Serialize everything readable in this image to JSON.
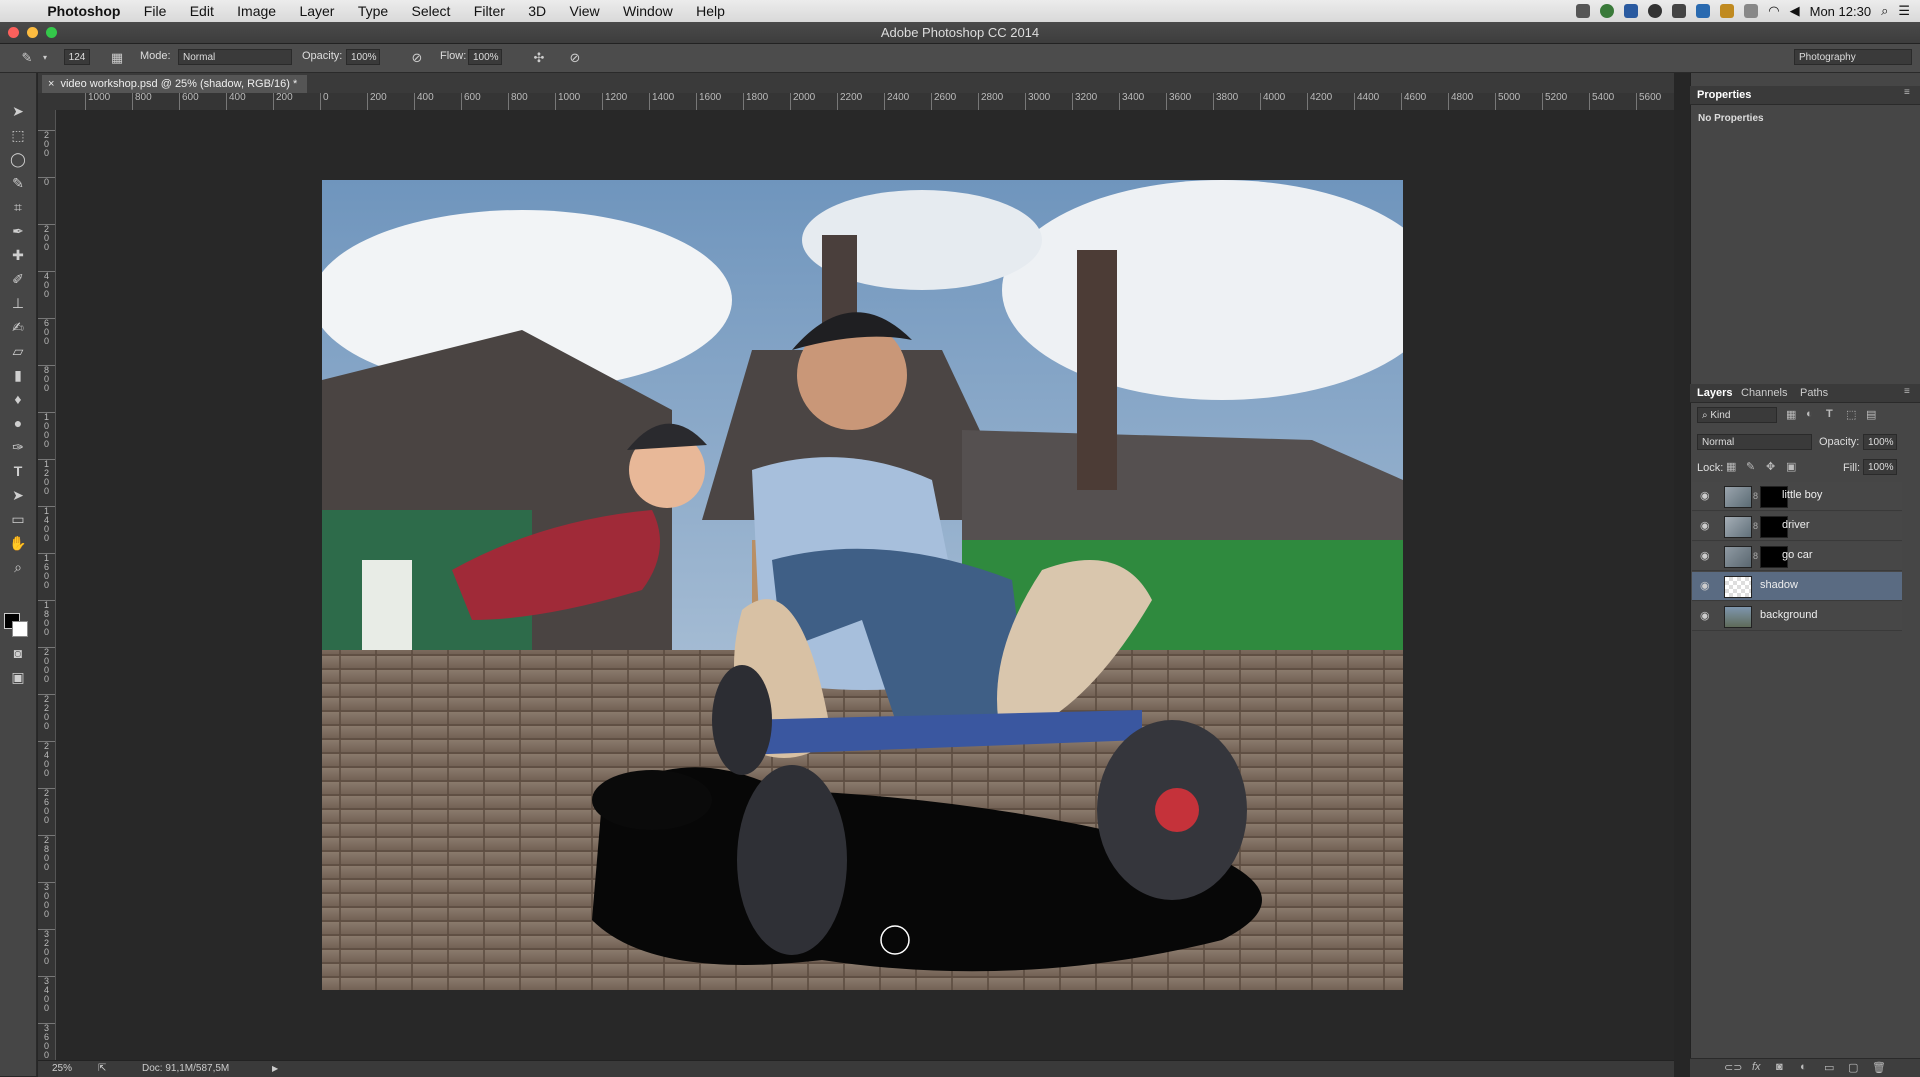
{
  "menubar": {
    "app": "Photoshop",
    "items": [
      "File",
      "Edit",
      "Image",
      "Layer",
      "Type",
      "Select",
      "Filter",
      "3D",
      "View",
      "Window",
      "Help"
    ],
    "clock": "Mon 12:30"
  },
  "window": {
    "title": "Adobe Photoshop CC 2014"
  },
  "options": {
    "brush_size": "124",
    "mode_label": "Mode:",
    "mode_value": "Normal",
    "opacity_label": "Opacity:",
    "opacity_value": "100%",
    "flow_label": "Flow:",
    "flow_value": "100%",
    "workspace": "Photography"
  },
  "document": {
    "tab_label": "video workshop.psd @ 25% (shadow, RGB/16) *",
    "zoom": "25%",
    "doc_info": "Doc: 91,1M/587,5M"
  },
  "hruler": [
    "1000",
    "800",
    "600",
    "400",
    "200",
    "0",
    "200",
    "400",
    "600",
    "800",
    "1000",
    "1200",
    "1400",
    "1600",
    "1800",
    "2000",
    "2200",
    "2400",
    "2600",
    "2800",
    "3000",
    "3200",
    "3400",
    "3600",
    "3800",
    "4000",
    "4200",
    "4400",
    "4600",
    "4800",
    "5000",
    "5200",
    "5400",
    "5600"
  ],
  "vruler": [
    "200",
    "0",
    "200",
    "400",
    "600",
    "800",
    "1000",
    "1200",
    "1400",
    "1600",
    "1800",
    "2000",
    "2200",
    "2400",
    "2600",
    "2800",
    "3000",
    "3200",
    "3400",
    "3600"
  ],
  "properties": {
    "tab": "Properties",
    "empty": "No Properties"
  },
  "layers_panel": {
    "tabs": [
      "Layers",
      "Channels",
      "Paths"
    ],
    "filter": "Kind",
    "blend": "Normal",
    "opacity_label": "Opacity:",
    "opacity_value": "100%",
    "lock_label": "Lock:",
    "fill_label": "Fill:",
    "fill_value": "100%",
    "layers": [
      {
        "name": "little boy",
        "selected": false
      },
      {
        "name": "driver",
        "selected": false
      },
      {
        "name": "go car",
        "selected": false
      },
      {
        "name": "shadow",
        "selected": true
      },
      {
        "name": "background",
        "selected": false
      }
    ]
  },
  "colors": {
    "selected_layer": "#5a6b82",
    "panel": "#464646",
    "canvas_bg": "#282828"
  }
}
